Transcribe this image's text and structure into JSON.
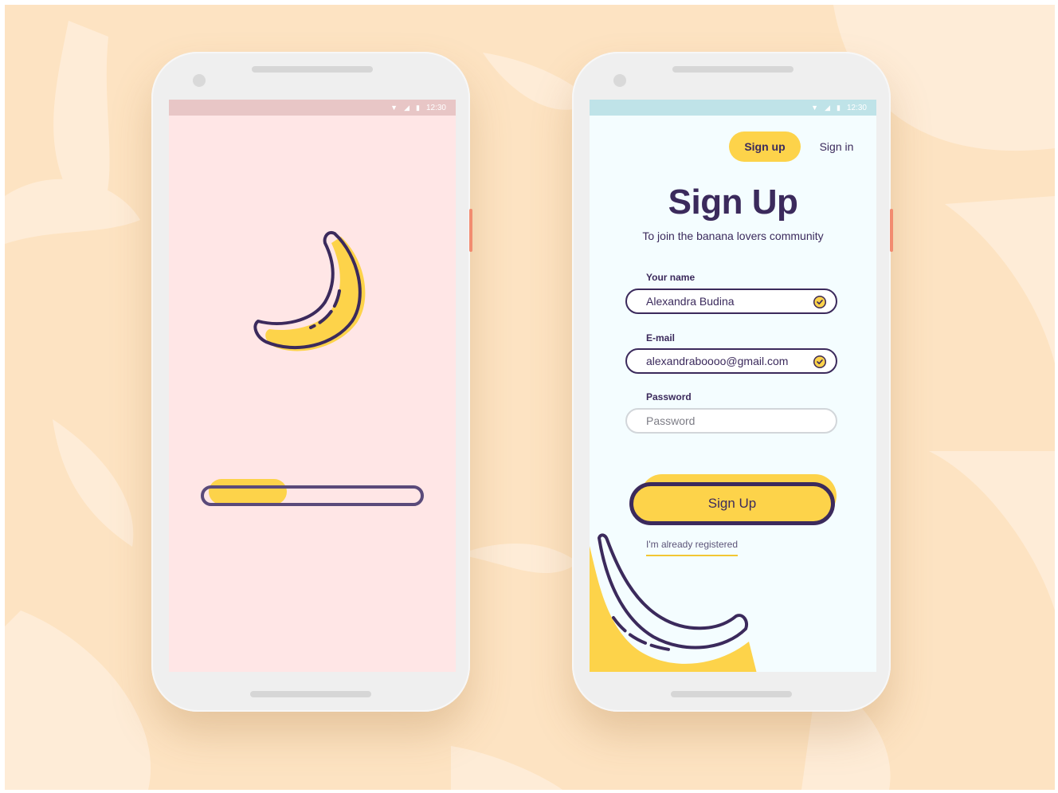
{
  "colors": {
    "background": "#fde3c2",
    "purple": "#3b2a5c",
    "yellow": "#fdd34a",
    "loader_screen": "#ffe6e6",
    "signup_screen": "#f4fdff"
  },
  "loader_screen": {
    "status_bar": {
      "time": "12:30",
      "icons": [
        "wifi-icon",
        "signal-icon",
        "battery-icon"
      ]
    },
    "progress": 0.35
  },
  "signup_screen": {
    "status_bar": {
      "time": "12:30",
      "icons": [
        "wifi-icon",
        "signal-icon",
        "battery-icon"
      ]
    },
    "tabs": [
      {
        "label": "Sign up",
        "active": true
      },
      {
        "label": "Sign in",
        "active": false
      }
    ],
    "title": "Sign Up",
    "subtitle": "To join the banana lovers community",
    "fields": [
      {
        "label": "Your name",
        "value": "Alexandra Budina",
        "valid": true
      },
      {
        "label": "E-mail",
        "value": "alexandraboooo@gmail.com",
        "valid": true
      },
      {
        "label": "Password",
        "value": "",
        "placeholder": "Password",
        "valid": false
      }
    ],
    "submit_label": "Sign Up",
    "already_registered": "I'm already registered"
  }
}
